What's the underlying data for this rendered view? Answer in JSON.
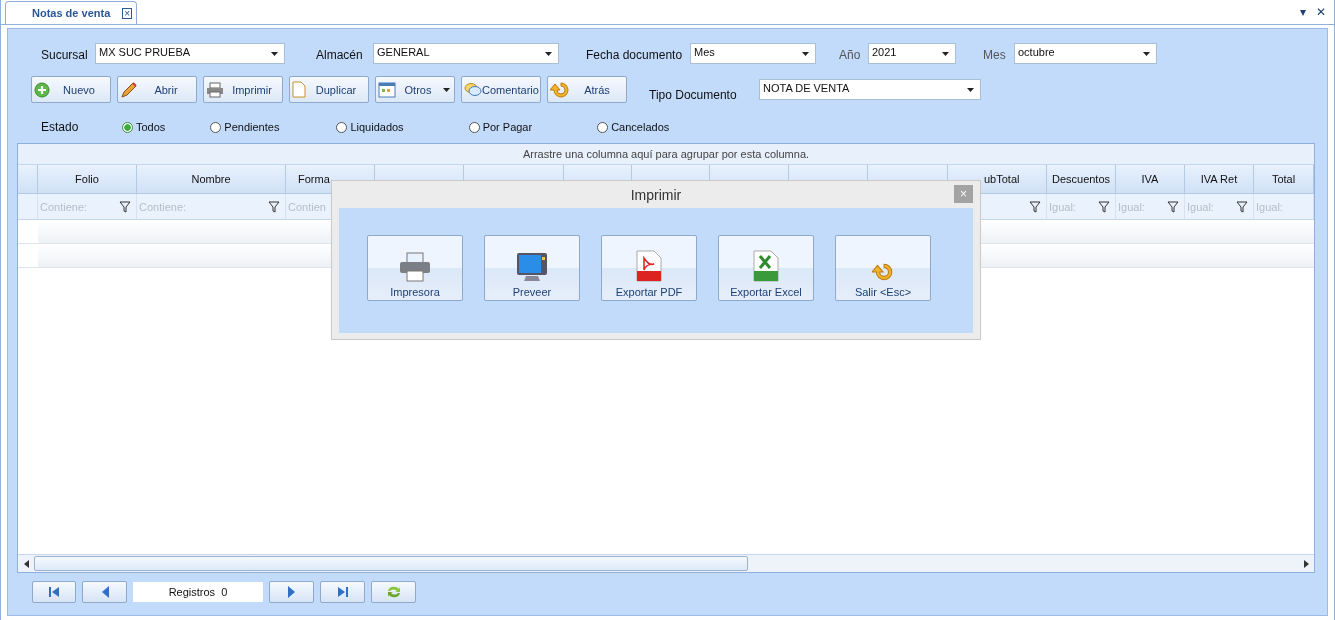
{
  "tab": {
    "title": "Notas de venta",
    "close": "×"
  },
  "header_controls": {
    "menu": "▾",
    "close": "✕"
  },
  "filters": [
    {
      "label": "Sucursal",
      "value": "MX SUC PRUEBA",
      "muted": false
    },
    {
      "label": "Almacén",
      "value": "GENERAL",
      "muted": false
    },
    {
      "label": "Fecha documento",
      "value": "Mes",
      "muted": false
    },
    {
      "label": "Año",
      "value": "2021",
      "muted": true
    },
    {
      "label": "Mes",
      "value": "octubre",
      "muted": true
    }
  ],
  "toolbar": [
    {
      "label": "Nuevo",
      "kind": "plus",
      "dropdown": false
    },
    {
      "label": "Abrir",
      "kind": "pencil",
      "dropdown": false
    },
    {
      "label": "Imprimir",
      "kind": "printer",
      "dropdown": false
    },
    {
      "label": "Duplicar",
      "kind": "page",
      "dropdown": false
    },
    {
      "label": "Otros",
      "kind": "calendar",
      "dropdown": true
    },
    {
      "label": "Comentario",
      "kind": "bubble",
      "dropdown": false
    },
    {
      "label": "Atrás",
      "kind": "back",
      "dropdown": false
    }
  ],
  "tipo_documento": {
    "label": "Tipo Documento",
    "value": "NOTA DE VENTA"
  },
  "estado": {
    "label": "Estado",
    "options": [
      {
        "label": "Todos",
        "selected": true
      },
      {
        "label": "Pendientes",
        "selected": false
      },
      {
        "label": "Liquidados",
        "selected": false
      },
      {
        "label": "Por Pagar",
        "selected": false
      },
      {
        "label": "Cancelados",
        "selected": false
      }
    ]
  },
  "grid": {
    "group_hint": "Arrastre una columna aquí para agrupar por esta columna.",
    "columns": [
      {
        "label": "Folio",
        "filter": "Contiene:",
        "funnel": true
      },
      {
        "label": "Nombre",
        "filter": "Contiene:",
        "funnel": true
      },
      {
        "label": "Forma",
        "filter": "Contien"
      },
      {
        "label": "ubTotal",
        "funnel": true
      },
      {
        "label": "Descuentos",
        "filter": "Igual:",
        "funnel": true
      },
      {
        "label": "IVA",
        "filter": "Igual:",
        "funnel": true
      },
      {
        "label": "IVA Ret",
        "filter": "Igual:",
        "funnel": true
      },
      {
        "label": "Total",
        "filter": "Igual:",
        "funnel": false
      }
    ]
  },
  "dialog": {
    "title": "Imprimir",
    "close": "×",
    "buttons": [
      {
        "label": "Impresora",
        "kind": "printer"
      },
      {
        "label": "Preveer",
        "kind": "monitor"
      },
      {
        "label": "Exportar PDF",
        "kind": "pdf"
      },
      {
        "label": "Exportar Excel",
        "kind": "xls"
      },
      {
        "label": "Salir <Esc>",
        "kind": "back"
      }
    ]
  },
  "footer": {
    "records": "Registros  0"
  }
}
